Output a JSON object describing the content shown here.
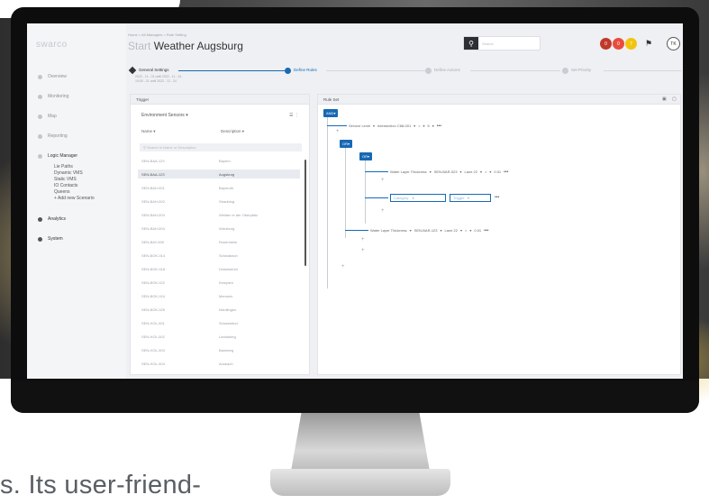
{
  "app": {
    "logo": "swarco",
    "breadcrumb": "Home > All Managers > Rule Setting",
    "title_prefix": "Start",
    "title": "Weather Augsburg",
    "search_placeholder": "Search",
    "badges": [
      {
        "label": "0",
        "color": "#c0392b"
      },
      {
        "label": "0",
        "color": "#e84c3d"
      },
      {
        "label": "7",
        "color": "#f1c40f"
      }
    ],
    "user_initials": "TK"
  },
  "sidebar": {
    "items": [
      {
        "label": "Overview"
      },
      {
        "label": "Monitoring"
      },
      {
        "label": "Map"
      },
      {
        "label": "Reporting"
      },
      {
        "label": "Logic Manager"
      }
    ],
    "sub_items": [
      "Lie Paths",
      "Dynamic VMS",
      "Static VMS",
      "IO Contacts",
      "Queens",
      "+ Add new Scenario"
    ],
    "bottom_items": [
      {
        "label": "Analytics"
      },
      {
        "label": "System"
      }
    ]
  },
  "steps": [
    {
      "label": "General Settings",
      "sub1": "2022 - 11 - 01 until 2022 - 11 - 24",
      "sub2": "15:00 - 21 until 2022 - 12 - 24",
      "state": "done"
    },
    {
      "label": "Define Rules",
      "state": "active"
    },
    {
      "label": "Define Actions",
      "state": "todo"
    },
    {
      "label": "Set Priority",
      "state": "todo"
    }
  ],
  "trigger_panel": {
    "header": "Trigger",
    "dropdown": "Environment Sensors",
    "col_name": "Name",
    "col_description": "Description",
    "search_placeholder": "Search in Name or Description",
    "rows": [
      {
        "name": "SEN-BAA-123",
        "desc": "Bayern"
      },
      {
        "name": "SEN-BAA-123",
        "desc": "Augsburg"
      },
      {
        "name": "SEN-BAH-001",
        "desc": "Bayreuth"
      },
      {
        "name": "SEN-BAH-002",
        "desc": "Straubing"
      },
      {
        "name": "SEN-BAH-003",
        "desc": "Weiden in der Oberpfalz"
      },
      {
        "name": "SEN-BAH-004",
        "desc": "Würzburg"
      },
      {
        "name": "SEN-BAY-009",
        "desc": "Rosenheim"
      },
      {
        "name": "SEN-BOK-014",
        "desc": "Schwabach"
      },
      {
        "name": "SEN-BOK-018",
        "desc": "Dinkelsbühl"
      },
      {
        "name": "SEN-BOK-022",
        "desc": "Kempten"
      },
      {
        "name": "SEN-BOK-024",
        "desc": "Memmin"
      },
      {
        "name": "SEN-BOK-025",
        "desc": "Nördlingen"
      },
      {
        "name": "SEN-HOL-001",
        "desc": "Schweinfurt"
      },
      {
        "name": "SEN-HOL-002",
        "desc": "Landsberg"
      },
      {
        "name": "SEN-HOL-003",
        "desc": "Bamberg"
      },
      {
        "name": "SEN-HOL-004",
        "desc": "Ansbach"
      }
    ]
  },
  "ruleset_panel": {
    "header": "Rule Set",
    "and_label": "AND",
    "or_label1": "OR",
    "or_label2": "OR",
    "rule1": {
      "field": "Service Level",
      "sensor": "Intersection C68-001",
      "op": ">",
      "val": "5"
    },
    "rule2": {
      "field": "Water Layer Thickness",
      "sensor": "SEN-BAR-023",
      "lane": "Lane 22",
      "op": ">",
      "val": "0.01"
    },
    "rule3": {
      "category": "Category",
      "trigger": "Trigger"
    },
    "rule4": {
      "field": "Water Layer Thickness",
      "sensor": "SEN-BAR-123",
      "lane": "Lane 22",
      "op": ">",
      "val": "0.01"
    }
  },
  "caption": "s. Its user-friend-"
}
